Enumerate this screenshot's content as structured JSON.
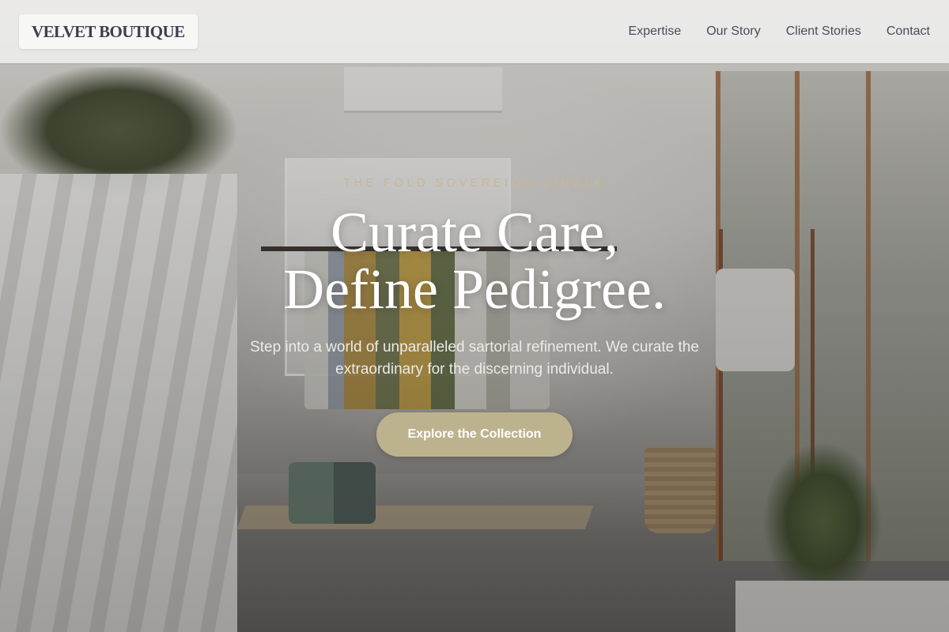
{
  "header": {
    "logo": "VELVET BOUTIQUE",
    "nav": [
      {
        "label": "Expertise"
      },
      {
        "label": "Our Story"
      },
      {
        "label": "Client Stories"
      },
      {
        "label": "Contact"
      }
    ]
  },
  "hero": {
    "eyebrow": "THE FOLD SOVEREIGN CIRCLE",
    "headline_line1": "Curate Care,",
    "headline_line2": "Define Pedigree.",
    "subtitle": "Step into a world of unparalleled sartorial refinement. We curate the extraordinary for the discerning individual.",
    "cta_label": "Explore the Collection"
  },
  "colors": {
    "accent": "#bcb38e",
    "eyebrow": "#c8b894",
    "logo_text": "#3d3f4c",
    "nav_text": "#4a4c57"
  }
}
